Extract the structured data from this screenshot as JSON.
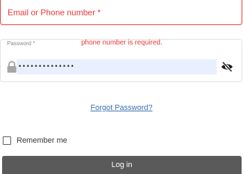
{
  "email_field": {
    "label": "Email or Phone number *"
  },
  "password_field": {
    "label": "Password *",
    "error": "phone number is required.",
    "value": "••••••••••••••",
    "icons": {
      "leading": "lock-icon",
      "trailing": "eye-slash-icon"
    },
    "autofill_color": "#e8f0fe"
  },
  "forgot_password": "Forgot Password?",
  "remember_me": {
    "label": "Remember me",
    "checked": false
  },
  "login_button": "Log in",
  "colors": {
    "error": "#e53935",
    "link": "#3b6fb0",
    "button": "#5a5a5a",
    "border": "#e0e0e0"
  }
}
